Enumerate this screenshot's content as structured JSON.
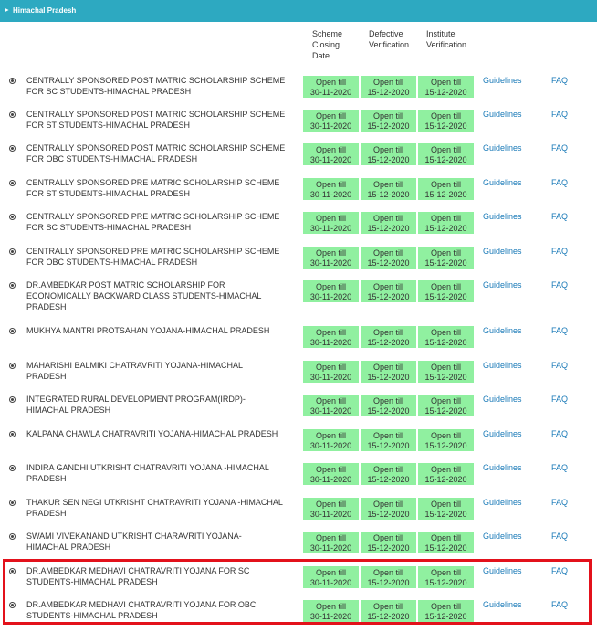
{
  "header": {
    "title": "Himachal Pradesh"
  },
  "columns": {
    "closing": [
      "Scheme",
      "Closing",
      "Date"
    ],
    "defective": [
      "Defective",
      "Verification"
    ],
    "institute": [
      "Institute",
      "Verification"
    ]
  },
  "colors": {
    "header": "#2da9c1",
    "open_cell": "#90f0a0",
    "link": "#1a7ab8",
    "highlight": "#e3111b"
  },
  "schemes": [
    {
      "name": [
        "CENTRALLY SPONSORED POST MATRIC SCHOLARSHIP SCHEME",
        "FOR SC STUDENTS-HIMACHAL PRADESH"
      ],
      "closing": [
        "Open till",
        "30-11-2020"
      ],
      "defective": [
        "Open till",
        "15-12-2020"
      ],
      "institute": [
        "Open till",
        "15-12-2020"
      ],
      "guidelines": "Guidelines",
      "faq": "FAQ"
    },
    {
      "name": [
        "CENTRALLY SPONSORED POST MATRIC SCHOLARSHIP SCHEME",
        "FOR ST STUDENTS-HIMACHAL PRADESH"
      ],
      "closing": [
        "Open till",
        "30-11-2020"
      ],
      "defective": [
        "Open till",
        "15-12-2020"
      ],
      "institute": [
        "Open till",
        "15-12-2020"
      ],
      "guidelines": "Guidelines",
      "faq": "FAQ"
    },
    {
      "name": [
        "CENTRALLY SPONSORED POST MATRIC SCHOLARSHIP SCHEME",
        "FOR OBC STUDENTS-HIMACHAL PRADESH"
      ],
      "closing": [
        "Open till",
        "30-11-2020"
      ],
      "defective": [
        "Open till",
        "15-12-2020"
      ],
      "institute": [
        "Open till",
        "15-12-2020"
      ],
      "guidelines": "Guidelines",
      "faq": "FAQ"
    },
    {
      "name": [
        "CENTRALLY SPONSORED PRE MATRIC SCHOLARSHIP SCHEME",
        "FOR ST STUDENTS-HIMACHAL PRADESH"
      ],
      "closing": [
        "Open till",
        "30-11-2020"
      ],
      "defective": [
        "Open till",
        "15-12-2020"
      ],
      "institute": [
        "Open till",
        "15-12-2020"
      ],
      "guidelines": "Guidelines",
      "faq": "FAQ"
    },
    {
      "name": [
        "CENTRALLY SPONSORED PRE MATRIC SCHOLARSHIP SCHEME",
        "FOR SC STUDENTS-HIMACHAL PRADESH"
      ],
      "closing": [
        "Open till",
        "30-11-2020"
      ],
      "defective": [
        "Open till",
        "15-12-2020"
      ],
      "institute": [
        "Open till",
        "15-12-2020"
      ],
      "guidelines": "Guidelines",
      "faq": "FAQ"
    },
    {
      "name": [
        "CENTRALLY SPONSORED PRE MATRIC SCHOLARSHIP SCHEME",
        "FOR OBC STUDENTS-HIMACHAL PRADESH"
      ],
      "closing": [
        "Open till",
        "30-11-2020"
      ],
      "defective": [
        "Open till",
        "15-12-2020"
      ],
      "institute": [
        "Open till",
        "15-12-2020"
      ],
      "guidelines": "Guidelines",
      "faq": "FAQ"
    },
    {
      "name": [
        "DR.AMBEDKAR POST MATRIC SCHOLARSHIP FOR",
        "ECONOMICALLY BACKWARD CLASS STUDENTS-HIMACHAL",
        "PRADESH"
      ],
      "closing": [
        "Open till",
        "30-11-2020"
      ],
      "defective": [
        "Open till",
        "15-12-2020"
      ],
      "institute": [
        "Open till",
        "15-12-2020"
      ],
      "guidelines": "Guidelines",
      "faq": "FAQ"
    },
    {
      "name": [
        "MUKHYA MANTRI PROTSAHAN YOJANA-HIMACHAL PRADESH"
      ],
      "closing": [
        "Open till",
        "30-11-2020"
      ],
      "defective": [
        "Open till",
        "15-12-2020"
      ],
      "institute": [
        "Open till",
        "15-12-2020"
      ],
      "guidelines": "Guidelines",
      "faq": "FAQ"
    },
    {
      "name": [
        "MAHARISHI BALMIKI CHATRAVRITI YOJANA-HIMACHAL",
        "PRADESH"
      ],
      "closing": [
        "Open till",
        "30-11-2020"
      ],
      "defective": [
        "Open till",
        "15-12-2020"
      ],
      "institute": [
        "Open till",
        "15-12-2020"
      ],
      "guidelines": "Guidelines",
      "faq": "FAQ"
    },
    {
      "name": [
        "INTEGRATED RURAL DEVELOPMENT PROGRAM(IRDP)-",
        "HIMACHAL PRADESH"
      ],
      "closing": [
        "Open till",
        "30-11-2020"
      ],
      "defective": [
        "Open till",
        "15-12-2020"
      ],
      "institute": [
        "Open till",
        "15-12-2020"
      ],
      "guidelines": "Guidelines",
      "faq": "FAQ"
    },
    {
      "name": [
        "KALPANA CHAWLA CHATRAVRITI YOJANA-HIMACHAL PRADESH"
      ],
      "closing": [
        "Open till",
        "30-11-2020"
      ],
      "defective": [
        "Open till",
        "15-12-2020"
      ],
      "institute": [
        "Open till",
        "15-12-2020"
      ],
      "guidelines": "Guidelines",
      "faq": "FAQ"
    },
    {
      "name": [
        "INDIRA GANDHI UTKRISHT CHATRAVRITI YOJANA -HIMACHAL",
        "PRADESH"
      ],
      "closing": [
        "Open till",
        "30-11-2020"
      ],
      "defective": [
        "Open till",
        "15-12-2020"
      ],
      "institute": [
        "Open till",
        "15-12-2020"
      ],
      "guidelines": "Guidelines",
      "faq": "FAQ"
    },
    {
      "name": [
        "THAKUR SEN NEGI UTKRISHT CHATRAVRITI YOJANA -HIMACHAL",
        "PRADESH"
      ],
      "closing": [
        "Open till",
        "30-11-2020"
      ],
      "defective": [
        "Open till",
        "15-12-2020"
      ],
      "institute": [
        "Open till",
        "15-12-2020"
      ],
      "guidelines": "Guidelines",
      "faq": "FAQ"
    },
    {
      "name": [
        "SWAMI VIVEKANAND UTKRISHT CHARAVRITI YOJANA-",
        "HIMACHAL PRADESH"
      ],
      "closing": [
        "Open till",
        "30-11-2020"
      ],
      "defective": [
        "Open till",
        "15-12-2020"
      ],
      "institute": [
        "Open till",
        "15-12-2020"
      ],
      "guidelines": "Guidelines",
      "faq": "FAQ"
    },
    {
      "name": [
        "DR.AMBEDKAR MEDHAVI CHATRAVRITI YOJANA FOR SC",
        "STUDENTS-HIMACHAL PRADESH"
      ],
      "closing": [
        "Open till",
        "30-11-2020"
      ],
      "defective": [
        "Open till",
        "15-12-2020"
      ],
      "institute": [
        "Open till",
        "15-12-2020"
      ],
      "guidelines": "Guidelines",
      "faq": "FAQ"
    },
    {
      "name": [
        "DR.AMBEDKAR MEDHAVI CHATRAVRITI YOJANA FOR OBC",
        "STUDENTS-HIMACHAL PRADESH"
      ],
      "closing": [
        "Open till",
        "30-11-2020"
      ],
      "defective": [
        "Open till",
        "15-12-2020"
      ],
      "institute": [
        "Open till",
        "15-12-2020"
      ],
      "guidelines": "Guidelines",
      "faq": "FAQ"
    }
  ]
}
